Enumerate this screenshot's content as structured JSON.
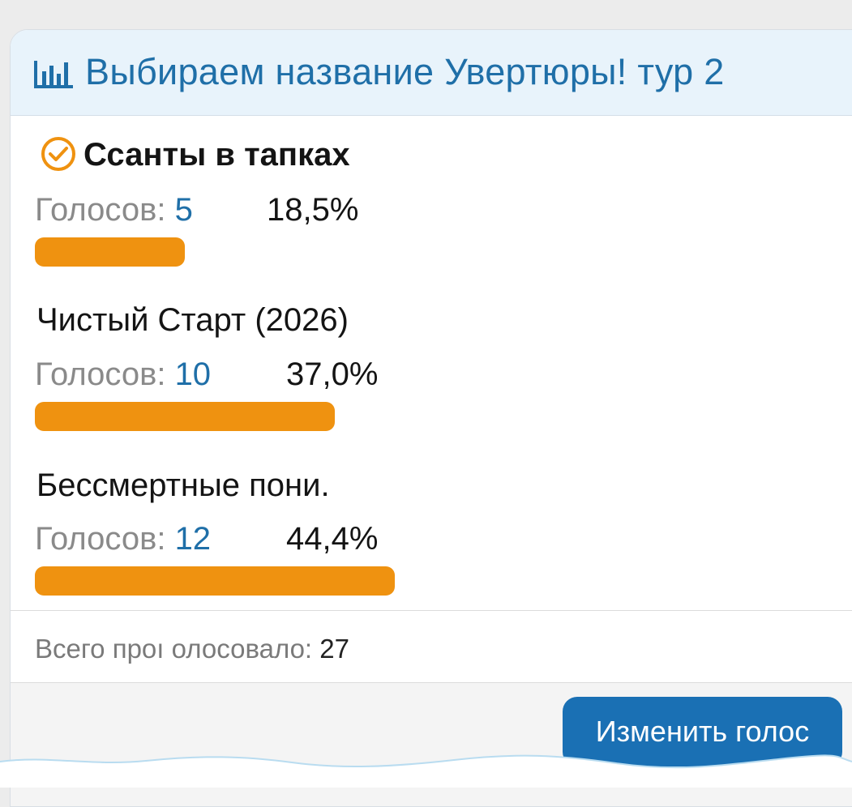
{
  "poll": {
    "title": "Выбираем название Увертюры! тур 2",
    "options": [
      {
        "label": "Ссанты в тапках",
        "votes_label": "Голосов: ",
        "votes": "5",
        "percent": "18,5%",
        "fraction": 0.185,
        "voted": true
      },
      {
        "label": "Чистый Старт (2026)",
        "votes_label": "Голосов: ",
        "votes": "10",
        "percent": "37,0%",
        "fraction": 0.37,
        "voted": false
      },
      {
        "label": "Бессмертные пони.",
        "votes_label": "Голосов: ",
        "votes": "12",
        "percent": "44,4%",
        "fraction": 0.444,
        "voted": false
      }
    ],
    "total_label": "Всего проı олосовало: ",
    "total": "27",
    "change_vote_label": "Изменить голос"
  },
  "colors": {
    "bar": "#ef9210",
    "accent": "#1f6fa8",
    "button": "#1a70b4",
    "header_bg": "#e8f3fb"
  },
  "icons": {
    "header": "bar-chart-icon",
    "voted": "check-circle-icon"
  }
}
